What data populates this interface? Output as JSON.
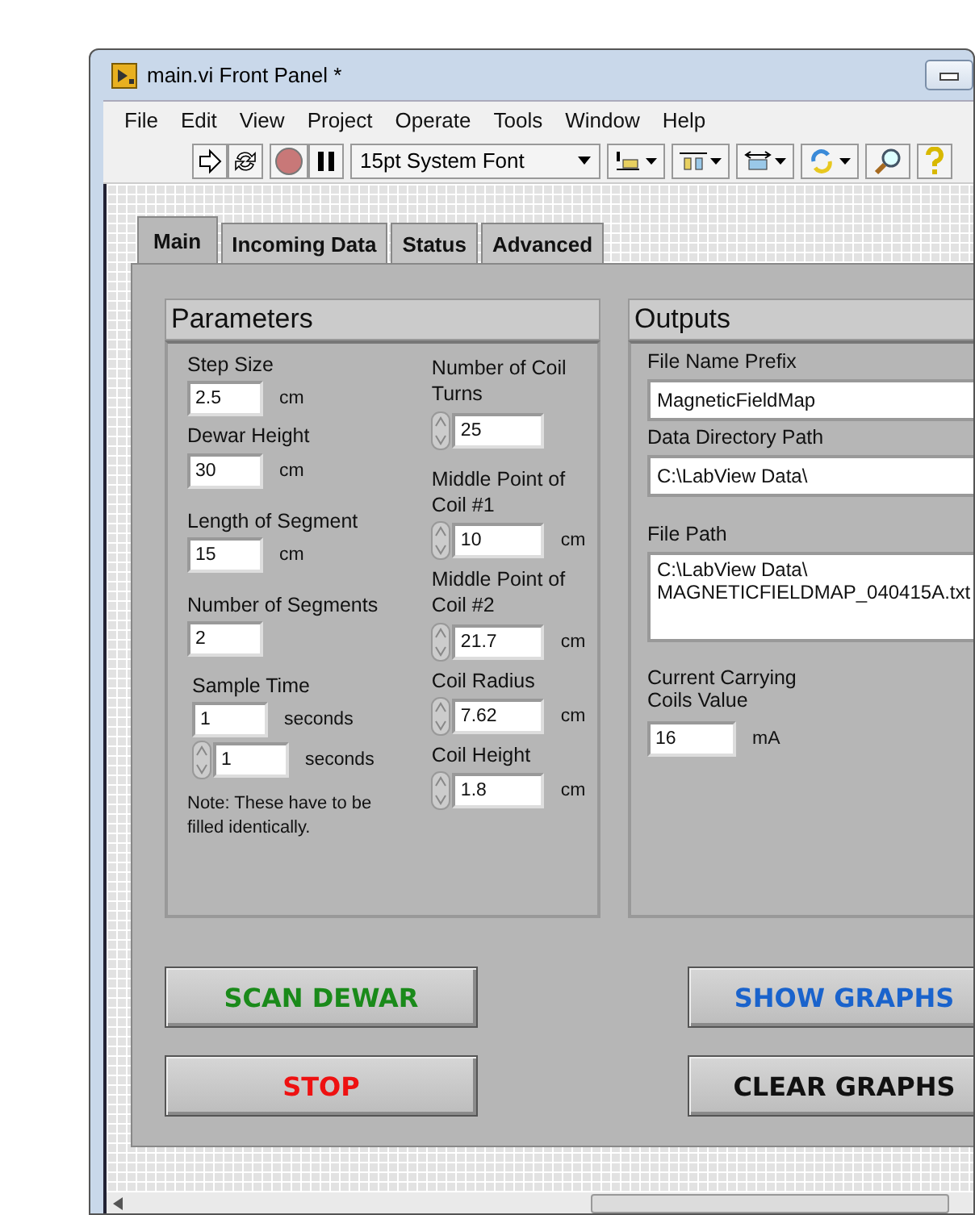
{
  "window": {
    "title": "main.vi Front Panel *"
  },
  "menu": [
    "File",
    "Edit",
    "View",
    "Project",
    "Operate",
    "Tools",
    "Window",
    "Help"
  ],
  "toolbar": {
    "font": "15pt System Font"
  },
  "tabs": [
    {
      "label": "Main",
      "selected": true
    },
    {
      "label": "Incoming Data",
      "selected": false
    },
    {
      "label": "Status",
      "selected": false
    },
    {
      "label": "Advanced",
      "selected": false
    }
  ],
  "parameters": {
    "title": "Parameters",
    "left": [
      {
        "label": "Step Size",
        "inputs": [
          {
            "value": "2.5",
            "unit": "cm",
            "spinner": false
          }
        ]
      },
      {
        "label": "Dewar Height",
        "inputs": [
          {
            "value": "30",
            "unit": "cm",
            "spinner": false
          }
        ]
      },
      {
        "label": "Length of Segment",
        "inputs": [
          {
            "value": "15",
            "unit": "cm",
            "spinner": false
          }
        ]
      },
      {
        "label": "Number of Segments",
        "inputs": [
          {
            "value": "2",
            "spinner": false
          }
        ]
      },
      {
        "label": "Sample Time",
        "inputs": [
          {
            "value": "1",
            "unit": "seconds",
            "spinner": false
          },
          {
            "value": "1",
            "unit": "seconds",
            "spinner": true
          }
        ]
      }
    ],
    "note": "Note: These have to be filled identically.",
    "right": [
      {
        "label": "Number of Coil Turns",
        "inputs": [
          {
            "value": "25",
            "spinner": true
          }
        ]
      },
      {
        "label": "Middle Point of Coil #1",
        "inputs": [
          {
            "value": "10",
            "unit": "cm",
            "spinner": true
          }
        ]
      },
      {
        "label": "Middle Point of Coil #2",
        "inputs": [
          {
            "value": "21.7",
            "unit": "cm",
            "spinner": true
          }
        ]
      },
      {
        "label": "Coil Radius",
        "inputs": [
          {
            "value": "7.62",
            "unit": "cm",
            "spinner": true
          }
        ]
      },
      {
        "label": "Coil Height",
        "inputs": [
          {
            "value": "1.8",
            "unit": "cm",
            "spinner": true
          }
        ]
      }
    ]
  },
  "outputs": {
    "title": "Outputs",
    "file_name_prefix": {
      "label": "File Name Prefix",
      "value": "MagneticFieldMap"
    },
    "data_directory_path": {
      "label": "Data Directory Path",
      "value": "C:\\LabView Data\\"
    },
    "file_path": {
      "label": "File Path",
      "lines": [
        "C:\\LabView Data\\",
        "MAGNETICFIELDMAP_040415A.txt"
      ]
    },
    "coils_value": {
      "label": "Current Carrying Coils Value",
      "value": "16",
      "unit": "mA"
    }
  },
  "buttons_left": [
    {
      "label": "SCAN DEWAR",
      "color": "#1a8a1a"
    },
    {
      "label": "STOP",
      "color": "#ee1111"
    }
  ],
  "buttons_right": [
    {
      "label": "SHOW GRAPHS",
      "color": "#1a63cc"
    },
    {
      "label": "CLEAR GRAPHS",
      "color": "#111111"
    }
  ]
}
